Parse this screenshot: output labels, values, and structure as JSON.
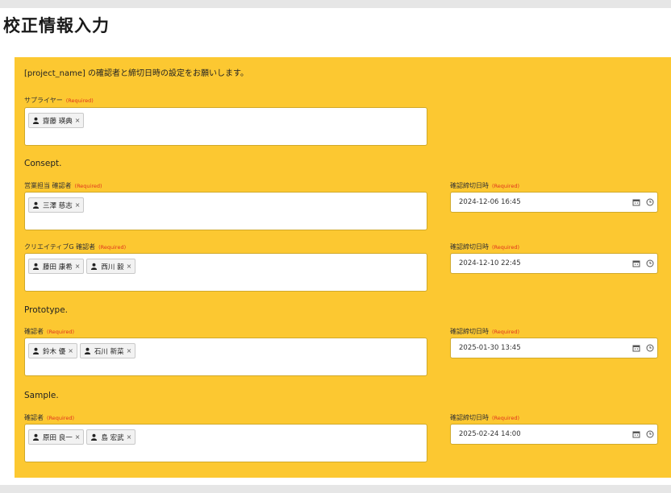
{
  "title": "校正情報入力",
  "intro": "[project_name] の確認者と締切日時の設定をお願いします。",
  "required_label": "(Required)",
  "supplier": {
    "label": "サプライヤー",
    "tags": [
      "齋藤 瑛典"
    ]
  },
  "consept": {
    "heading": "Consept.",
    "rows": [
      {
        "label": "営業担当 確認者",
        "tags": [
          "三澤 慈志"
        ],
        "deadline_label": "確認締切日時",
        "deadline": "2024-12-06 16:45"
      },
      {
        "label": "クリエイティブG 確認者",
        "tags": [
          "藤田 康希",
          "西川 毅"
        ],
        "deadline_label": "確認締切日時",
        "deadline": "2024-12-10 22:45"
      }
    ]
  },
  "prototype": {
    "heading": "Prototype.",
    "rows": [
      {
        "label": "確認者",
        "tags": [
          "鈴木 優",
          "石川 新菜"
        ],
        "deadline_label": "確認締切日時",
        "deadline": "2025-01-30 13:45"
      }
    ]
  },
  "sample": {
    "heading": "Sample.",
    "rows": [
      {
        "label": "確認者",
        "tags": [
          "原田 良一",
          "島 宏武"
        ],
        "deadline_label": "確認締切日時",
        "deadline": "2025-02-24 14:00"
      }
    ]
  },
  "icons": {
    "tag": "user-icon",
    "tag_remove": "close-icon",
    "date_calendar": "calendar-icon",
    "date_time": "clock-icon"
  },
  "colors": {
    "panel": "#fcc831",
    "required": "#e0341e"
  }
}
